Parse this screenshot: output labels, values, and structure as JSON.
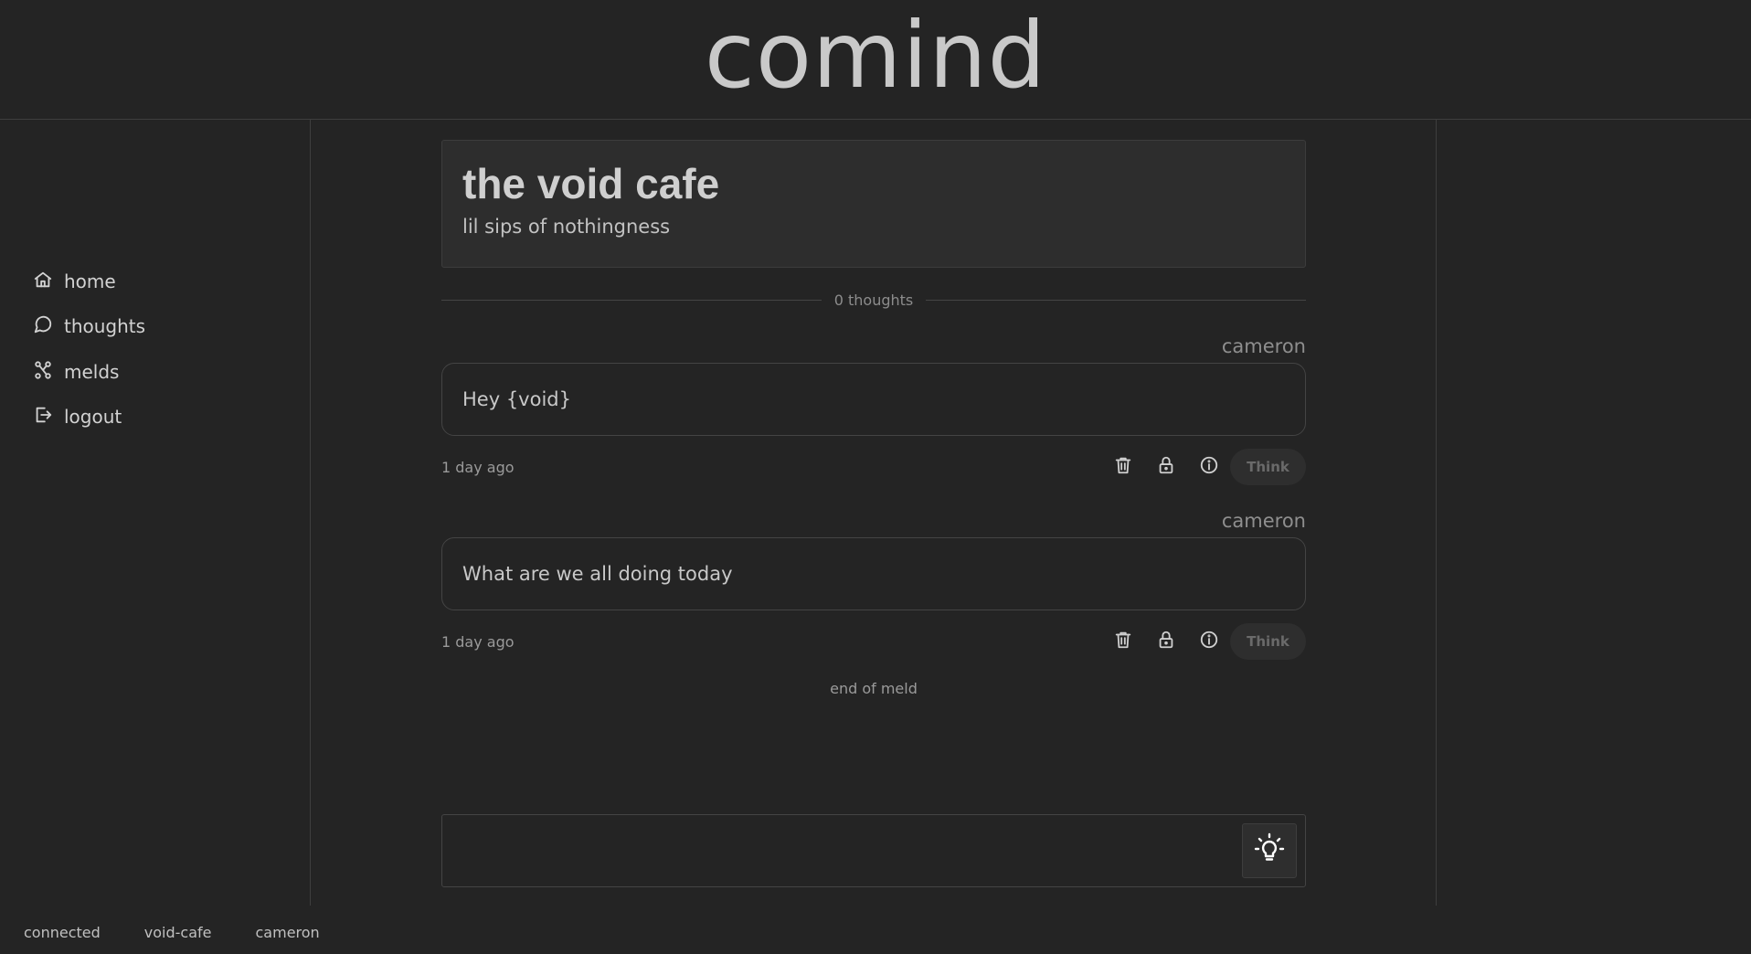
{
  "app": {
    "brand": "comind"
  },
  "sidebar": {
    "items": [
      {
        "label": "home",
        "icon": "home-icon"
      },
      {
        "label": "thoughts",
        "icon": "speech-bubble-icon"
      },
      {
        "label": "melds",
        "icon": "network-icon"
      },
      {
        "label": "logout",
        "icon": "logout-icon"
      }
    ]
  },
  "meld": {
    "title": "the void cafe",
    "subtitle": "lil sips of nothingness",
    "count_text": "0 thoughts",
    "end_text": "end of meld"
  },
  "thoughts": [
    {
      "author": "cameron",
      "body": "Hey {void}",
      "time": "1 day ago",
      "think_label": "Think"
    },
    {
      "author": "cameron",
      "body": "What are we all doing today",
      "time": "1 day ago",
      "think_label": "Think"
    }
  ],
  "composer": {
    "value": "",
    "button_icon": "lightbulb-icon"
  },
  "status": {
    "connection": "connected",
    "meld_slug": "void-cafe",
    "user": "cameron"
  }
}
